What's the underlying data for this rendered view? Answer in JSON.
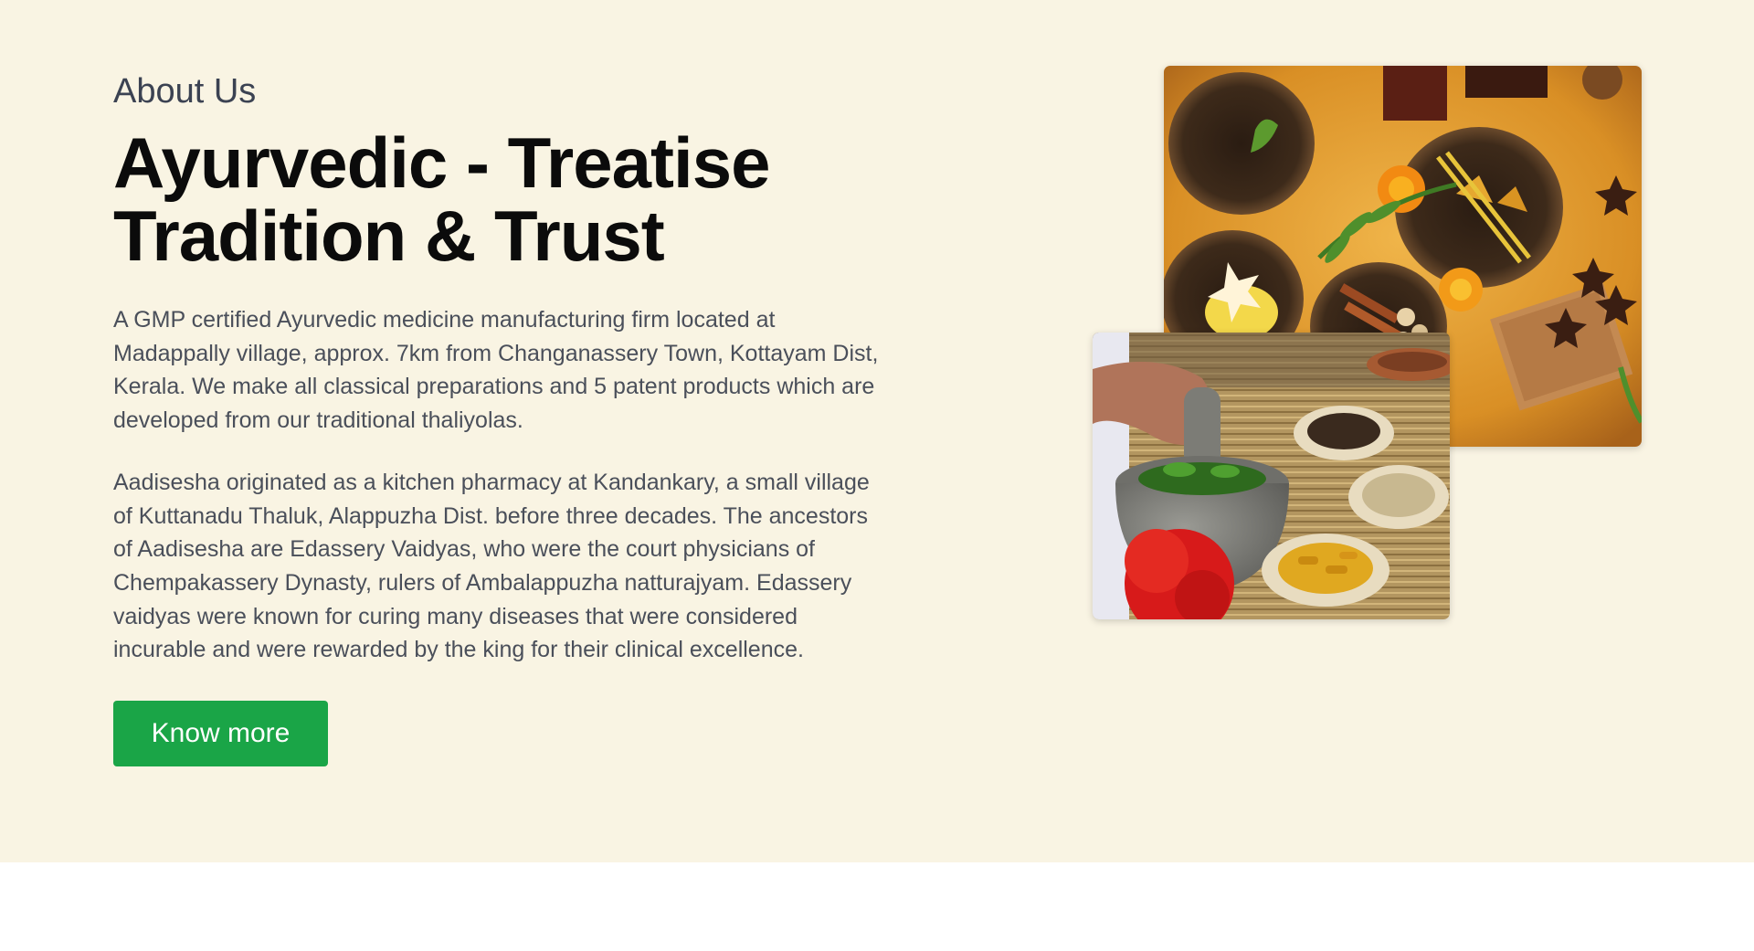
{
  "about": {
    "eyebrow": "About Us",
    "headline_line1": "Ayurvedic - Treatise",
    "headline_line2": "Tradition & Trust",
    "paragraph1": "A GMP certified Ayurvedic medicine manufacturing firm located at Madappally village, approx. 7km from Changanassery Town, Kottayam Dist, Kerala. We make all classical preparations and 5 patent products which are developed from our traditional thaliyolas.",
    "paragraph2": "Aadisesha originated as a kitchen pharmacy at Kandankary, a small village of Kuttanadu Thaluk, Alappuzha Dist. before three decades. The ancestors of Aadisesha are Edassery Vaidyas, who were the court physicians of Chempakassery Dynasty, rulers of Ambalappuzha natturajyam. Edassery vaidyas were known for curing many diseases that were considered incurable and were rewarded by the king for their clinical excellence.",
    "button_label": "Know more"
  },
  "colors": {
    "section_background": "#f9f4e3",
    "button_green": "#1aa547",
    "heading_text": "#0b0b0b",
    "body_text": "#4a4f5a"
  },
  "images": {
    "spices": "ayurvedic-spices-in-coconut-bowls",
    "mortar": "herbs-grinding-in-stone-mortar"
  }
}
